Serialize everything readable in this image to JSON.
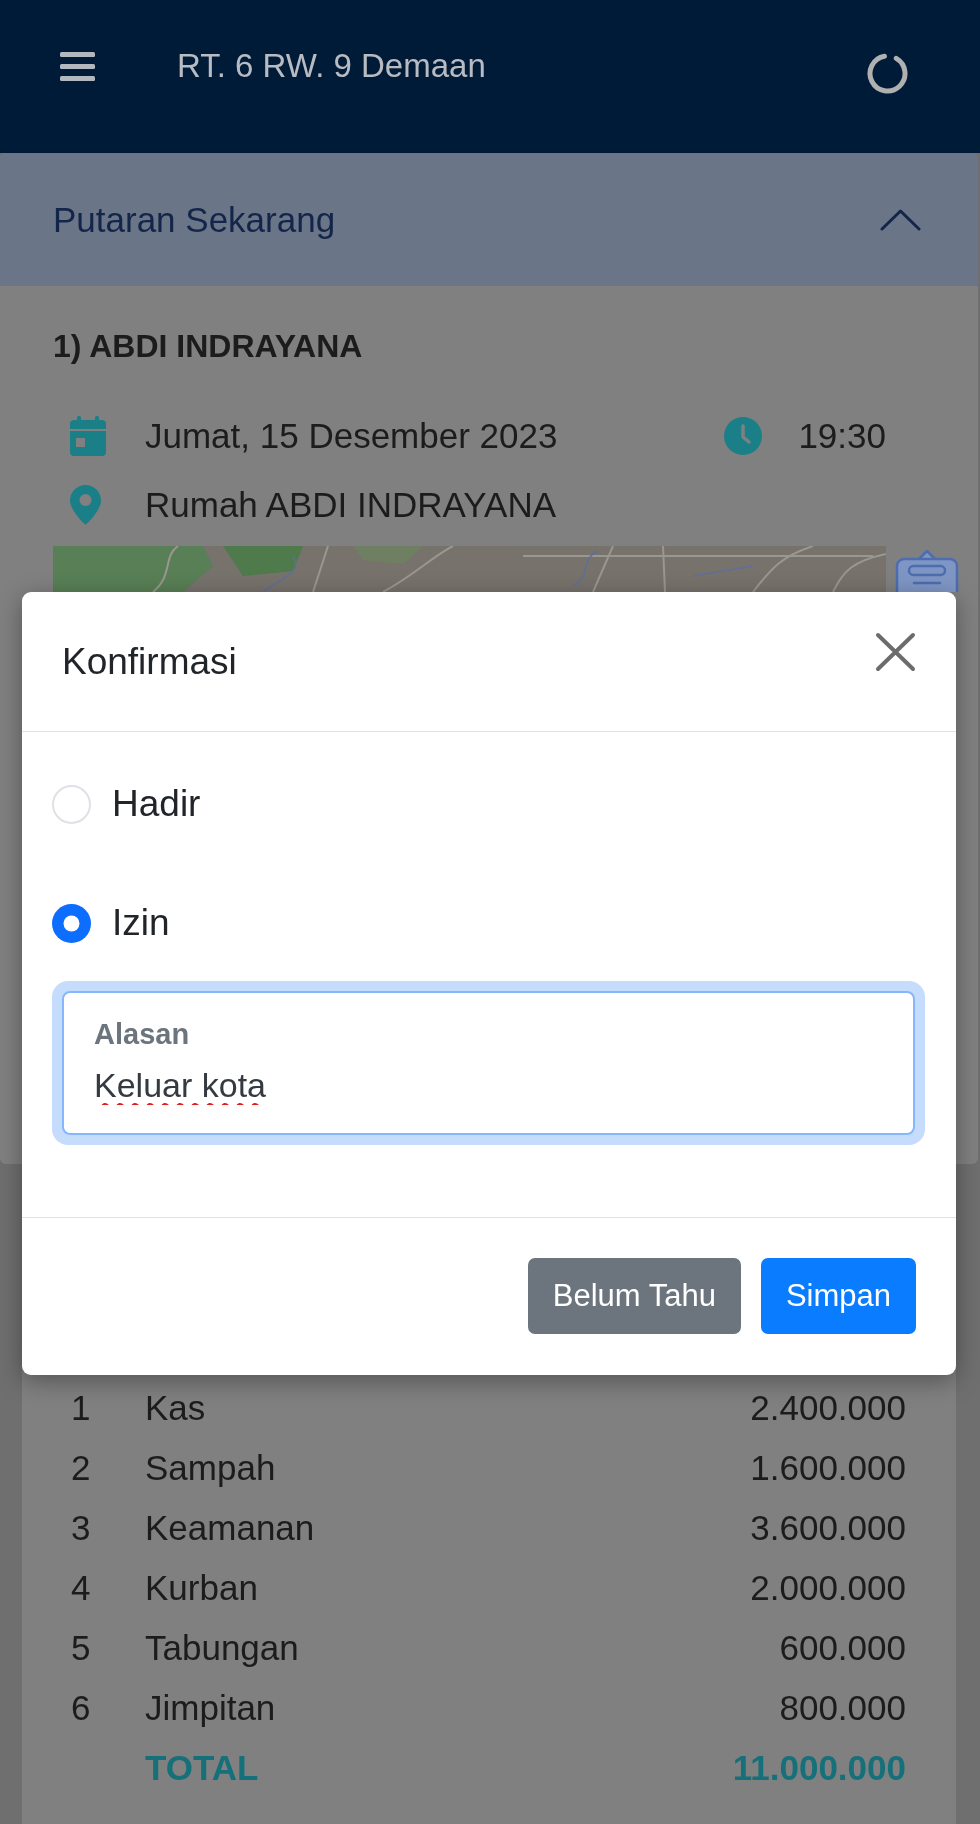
{
  "app_bar": {
    "title": "RT. 6 RW. 9 Demaan"
  },
  "accordion": {
    "title": "Putaran Sekarang",
    "expanded": true,
    "event": {
      "title": "1) ABDI INDRAYANA",
      "date": "Jumat, 15 Desember 2023",
      "time": "19:30",
      "location": "Rumah ABDI INDRAYANA"
    }
  },
  "dialog": {
    "title": "Konfirmasi",
    "options": [
      {
        "label": "Hadir",
        "selected": false
      },
      {
        "label": "Izin",
        "selected": true
      }
    ],
    "reason_field": {
      "label": "Alasan",
      "value": "Keluar kota",
      "focused": true
    },
    "buttons": [
      {
        "label": "Belum Tahu",
        "kind": "secondary"
      },
      {
        "label": "Simpan",
        "kind": "primary"
      }
    ]
  },
  "dues_table": {
    "rows": [
      {
        "number": "1",
        "name": "Kas",
        "amount": "2.400.000"
      },
      {
        "number": "2",
        "name": "Sampah",
        "amount": "1.600.000"
      },
      {
        "number": "3",
        "name": "Keamanan",
        "amount": "3.600.000"
      },
      {
        "number": "4",
        "name": "Kurban",
        "amount": "2.000.000"
      },
      {
        "number": "5",
        "name": "Tabungan",
        "amount": "600.000"
      },
      {
        "number": "6",
        "name": "Jimpitan",
        "amount": "800.000"
      }
    ],
    "total": {
      "label": "TOTAL",
      "amount": "11.000.000"
    }
  }
}
